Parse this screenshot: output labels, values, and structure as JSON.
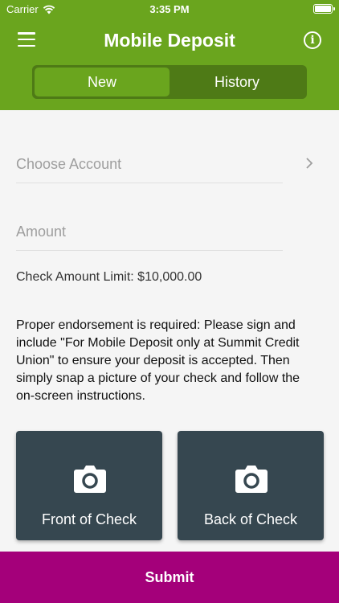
{
  "status_bar": {
    "carrier": "Carrier",
    "time": "3:35 PM"
  },
  "header": {
    "title": "Mobile Deposit"
  },
  "tabs": [
    {
      "label": "New",
      "active": true
    },
    {
      "label": "History",
      "active": false
    }
  ],
  "form": {
    "account_placeholder": "Choose Account",
    "amount_placeholder": "Amount",
    "limit_text": "Check Amount Limit: $10,000.00",
    "instructions": "Proper endorsement is required: Please sign and include \"For Mobile Deposit only at Summit Credit Union\" to ensure your deposit is accepted. Then simply snap a picture of your check and follow the on-screen instructions."
  },
  "check_buttons": {
    "front_label": "Front of Check",
    "back_label": "Back of Check"
  },
  "submit_label": "Submit",
  "icons": {
    "menu": "menu-icon",
    "info": "info-icon",
    "chevron": "chevron-right-icon",
    "camera": "camera-icon",
    "wifi": "wifi-icon",
    "battery": "battery-icon"
  },
  "colors": {
    "header_green": "#6aa51e",
    "segment_dark": "#4e7a16",
    "card_slate": "#364750",
    "submit_magenta": "#a4007a"
  }
}
